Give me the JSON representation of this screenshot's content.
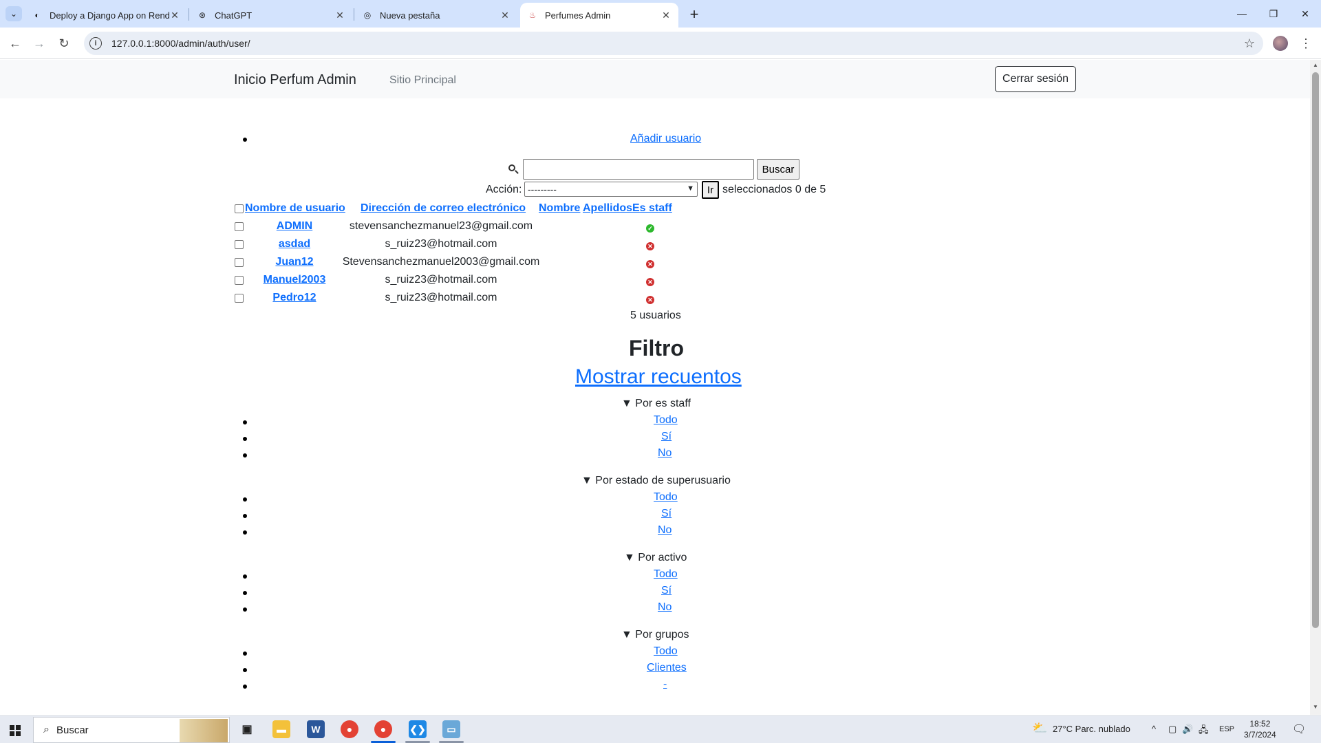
{
  "browser": {
    "tabs": [
      {
        "title": "Deploy a Django App on Render",
        "active": false
      },
      {
        "title": "ChatGPT",
        "active": false
      },
      {
        "title": "Nueva pestaña",
        "active": false
      },
      {
        "title": "Perfumes Admin",
        "active": true
      }
    ],
    "url": "127.0.0.1:8000/admin/auth/user/"
  },
  "header": {
    "brand": "Inicio Perfum Admin",
    "site_link": "Sitio Principal",
    "logout": "Cerrar sesión"
  },
  "actions": {
    "add_user": "Añadir usuario",
    "search_value": "",
    "search_button": "Buscar",
    "action_label": "Acción:",
    "action_selected": "---------",
    "go_button": "Ir",
    "selected_text": "seleccionados 0 de 5"
  },
  "table": {
    "headers": {
      "username": "Nombre de usuario",
      "email": "Dirección de correo electrónico",
      "first_name": "Nombre",
      "last_name": "Apellidos",
      "is_staff": "Es staff"
    },
    "rows": [
      {
        "username": "ADMIN",
        "email": "stevensanchezmanuel23@gmail.com",
        "is_staff": true
      },
      {
        "username": "asdad",
        "email": "s_ruiz23@hotmail.com",
        "is_staff": false
      },
      {
        "username": "Juan12",
        "email": "Stevensanchezmanuel2003@gmail.com",
        "is_staff": false
      },
      {
        "username": "Manuel2003",
        "email": "s_ruiz23@hotmail.com",
        "is_staff": false
      },
      {
        "username": "Pedro12",
        "email": "s_ruiz23@hotmail.com",
        "is_staff": false
      }
    ],
    "count": "5 usuarios"
  },
  "filter": {
    "title": "Filtro",
    "show_counts": "Mostrar recuentos",
    "groups": [
      {
        "title": "▼ Por es staff",
        "options": [
          "Todo",
          "Sí",
          "No"
        ]
      },
      {
        "title": "▼ Por estado de superusuario",
        "options": [
          "Todo",
          "Sí",
          "No"
        ]
      },
      {
        "title": "▼ Por activo",
        "options": [
          "Todo",
          "Sí",
          "No"
        ]
      },
      {
        "title": "▼ Por grupos",
        "options": [
          "Todo",
          "Clientes",
          "-"
        ]
      }
    ]
  },
  "taskbar": {
    "search": "Buscar",
    "weather": "27°C  Parc. nublado",
    "lang": "ESP",
    "time": "18:52",
    "date": "3/7/2024"
  },
  "colors": {
    "link": "#0d6efd",
    "staff_yes": "#2db82d",
    "staff_no": "#d03030",
    "tabstrip": "#d3e3fd"
  }
}
